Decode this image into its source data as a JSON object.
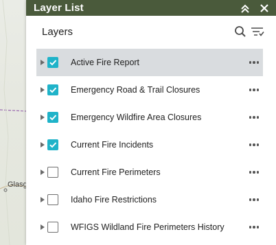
{
  "map": {
    "place_label": "Glasgo",
    "colors": {
      "border_line": "#9b6bb0",
      "road": "#c9b38c"
    }
  },
  "panel": {
    "title": "Layer List",
    "collapse_icon": "chevron-double-up-icon",
    "close_icon": "close-icon",
    "header_color": "#4a5a3b"
  },
  "header": {
    "title": "Layers",
    "search_icon": "search-icon",
    "filter_icon": "filter-list-icon"
  },
  "layers": [
    {
      "label": "Active Fire Report",
      "checked": true,
      "selected": true
    },
    {
      "label": "Emergency Road & Trail Closures",
      "checked": true,
      "selected": false
    },
    {
      "label": "Emergency Wildfire Area Closures",
      "checked": true,
      "selected": false
    },
    {
      "label": "Current Fire Incidents",
      "checked": true,
      "selected": false
    },
    {
      "label": "Current Fire Perimeters",
      "checked": false,
      "selected": false
    },
    {
      "label": "Idaho Fire Restrictions",
      "checked": false,
      "selected": false
    },
    {
      "label": "WFIGS Wildland Fire Perimeters History",
      "checked": false,
      "selected": false
    }
  ],
  "accent_color": "#1fb3c9"
}
